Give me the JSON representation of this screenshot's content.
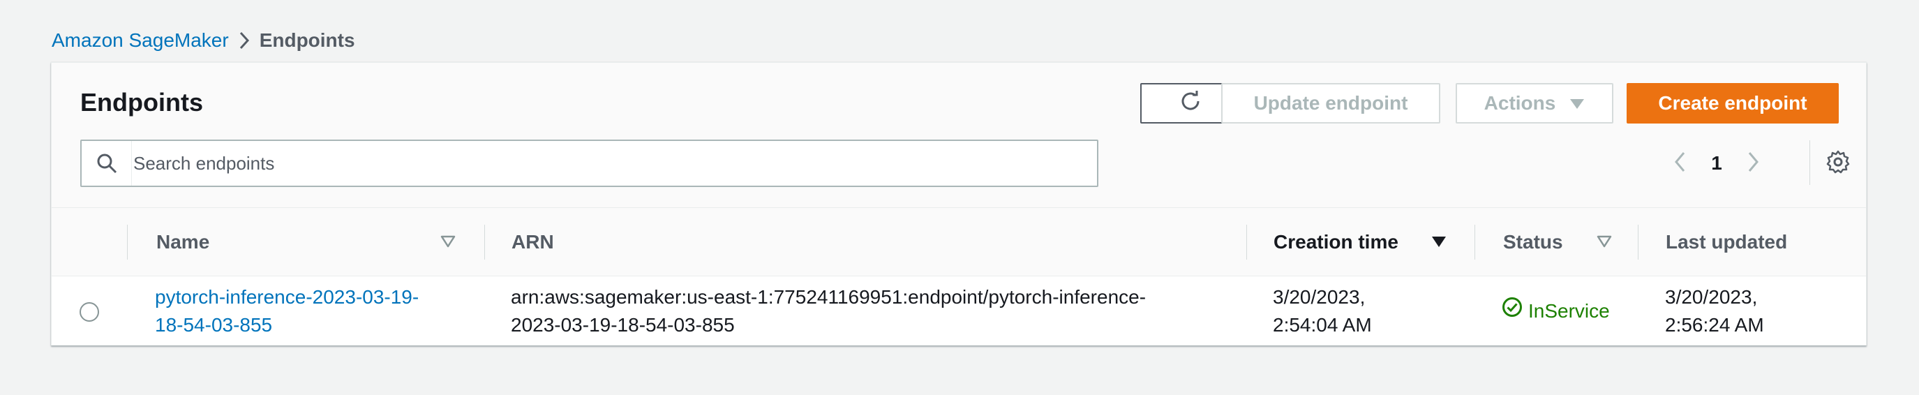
{
  "breadcrumb": {
    "parent": "Amazon SageMaker",
    "current": "Endpoints"
  },
  "panel": {
    "title": "Endpoints",
    "buttons": {
      "refresh_icon": "refresh-icon",
      "update": "Update endpoint",
      "actions": "Actions",
      "create": "Create endpoint"
    },
    "search": {
      "placeholder": "Search endpoints",
      "value": ""
    },
    "pagination": {
      "current_page": "1"
    }
  },
  "table": {
    "columns": [
      "Name",
      "ARN",
      "Creation time",
      "Status",
      "Last updated"
    ],
    "rows": [
      {
        "name_line1": "pytorch-inference-2023-03-19-",
        "name_line2": "18-54-03-855",
        "arn_line1": "arn:aws:sagemaker:us-east-1:775241169951:endpoint/pytorch-inference-",
        "arn_line2": "2023-03-19-18-54-03-855",
        "created_line1": "3/20/2023,",
        "created_line2": "2:54:04 AM",
        "status": "InService",
        "updated_line1": "3/20/2023,",
        "updated_line2": "2:56:24 AM"
      }
    ]
  },
  "colors": {
    "link": "#0073bb",
    "primary_button": "#ec7211",
    "success": "#1d8102",
    "page_background": "#f2f3f3"
  }
}
